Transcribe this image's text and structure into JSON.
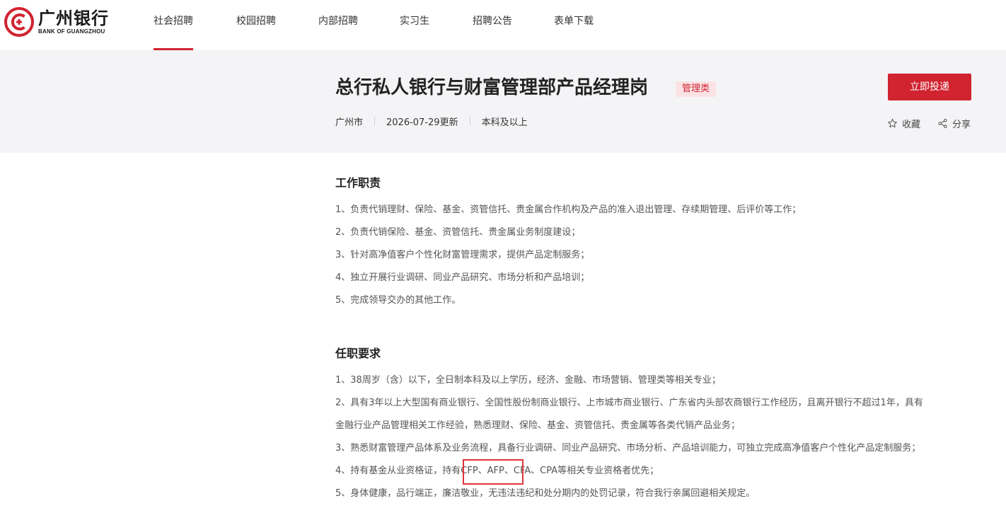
{
  "brand": {
    "name_cn": "广州银行",
    "name_en": "BANK OF GUANGZHOU",
    "accent_color": "#d12330"
  },
  "nav": {
    "items": [
      {
        "label": "社会招聘",
        "active": true
      },
      {
        "label": "校园招聘",
        "active": false
      },
      {
        "label": "内部招聘",
        "active": false
      },
      {
        "label": "实习生",
        "active": false
      },
      {
        "label": "招聘公告",
        "active": false
      },
      {
        "label": "表单下载",
        "active": false
      }
    ]
  },
  "job": {
    "title": "总行私人银行与财富管理部产品经理岗",
    "category_tag": "管理类",
    "location": "广州市",
    "updated": "2026-07-29更新",
    "education": "本科及以上",
    "apply_label": "立即投递",
    "favorite_label": "收藏",
    "share_label": "分享"
  },
  "duties": {
    "title": "工作职责",
    "items": [
      "1、负责代销理财、保险、基金、资管信托、贵金属合作机构及产品的准入退出管理、存续期管理、后评价等工作；",
      "2、负责代销保险、基金、资管信托、贵金属业务制度建设；",
      "3、针对高净值客户个性化财富管理需求，提供产品定制服务；",
      "4、独立开展行业调研、同业产品研究、市场分析和产品培训；",
      "5、完成领导交办的其他工作。"
    ]
  },
  "requirements": {
    "title": "任职要求",
    "items": [
      "1、38周岁（含）以下，全日制本科及以上学历，经济、金融、市场营销、管理类等相关专业；",
      "2、具有3年以上大型国有商业银行、全国性股份制商业银行、上市城市商业银行、广东省内头部农商银行工作经历，且离开银行不超过1年，具有",
      "金融行业产品管理相关工作经验，熟悉理财、保险、基金、资管信托、贵金属等各类代销产品业务；",
      "3、熟悉财富管理产品体系及业务流程，具备行业调研、同业产品研究、市场分析、产品培训能力，可独立完成高净值客户个性化产品定制服务；",
      "4、持有基金从业资格证，持有CFP、AFP、CFA、CPA等相关专业资格者优先；",
      "5、身体健康，品行端正，廉洁敬业，无违法违纪和处分期内的处罚记录，符合我行亲属回避相关规定。"
    ]
  }
}
